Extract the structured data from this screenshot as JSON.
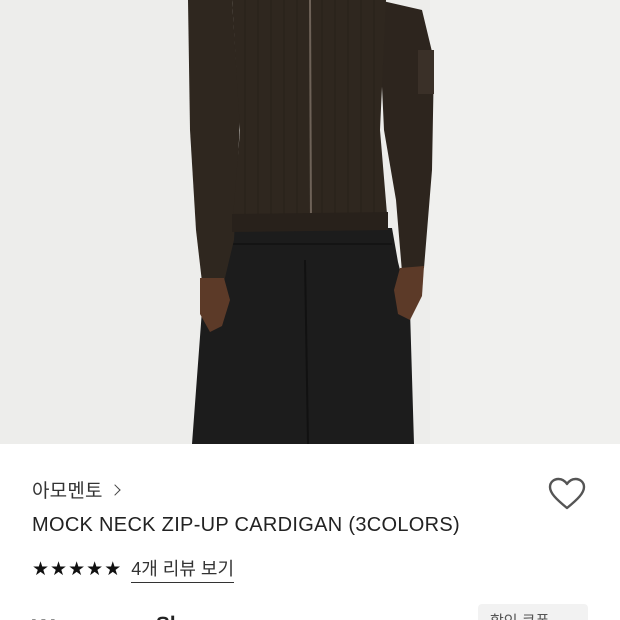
{
  "product_image": {
    "alt": "",
    "colors": {
      "backdrop": "#ededeb",
      "cardigan": "#2f271f",
      "pants": "#1c1c1c",
      "skin": "#5c3a28"
    }
  },
  "brand": {
    "name": "아모멘토",
    "chevron_icon": "chevron-right-icon"
  },
  "wishlist": {
    "icon": "heart-outline-icon"
  },
  "product": {
    "name": "MOCK NECK ZIP-UP CARDIGAN (3COLORS)"
  },
  "rating": {
    "stars": 5,
    "max_stars": 5,
    "star_glyph": "★",
    "review_link": "4개 리뷰 보기"
  },
  "price": {
    "amount": "₩ ___,___ 원"
  },
  "side_chip": {
    "label": "할인 쿠폰"
  }
}
